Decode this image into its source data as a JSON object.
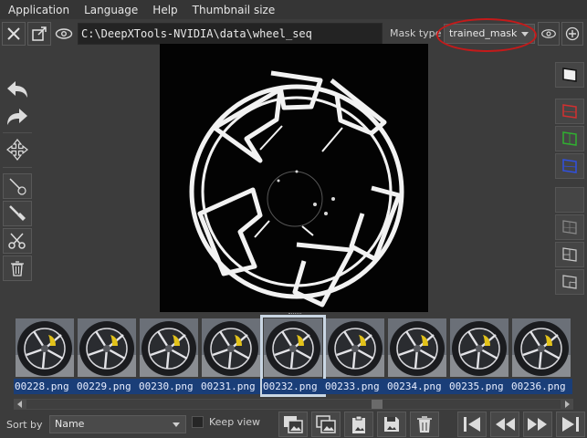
{
  "menu": [
    "Application",
    "Language",
    "Help",
    "Thumbnail size"
  ],
  "toolbar": {
    "path": "C:\\DeepXTools-NVIDIA\\data\\wheel_seq",
    "mask_type_label": "Mask type",
    "mask_type_value": "trained_mask"
  },
  "thumbnails": [
    {
      "label": "00228.png"
    },
    {
      "label": "00229.png"
    },
    {
      "label": "00230.png"
    },
    {
      "label": "00231.png"
    },
    {
      "label": "00232.png",
      "selected": true
    },
    {
      "label": "00233.png"
    },
    {
      "label": "00234.png"
    },
    {
      "label": "00235.png"
    },
    {
      "label": "00236.png"
    }
  ],
  "bottom": {
    "sort_label": "Sort by",
    "sort_value": "Name",
    "keep_view_label": "Keep view"
  },
  "colors": {
    "highlight_ring": "#c41a1a",
    "thumb_label_bg": "#1a3e78",
    "mask_red": "#d23030",
    "mask_green": "#30b030",
    "mask_blue": "#3050e0"
  }
}
